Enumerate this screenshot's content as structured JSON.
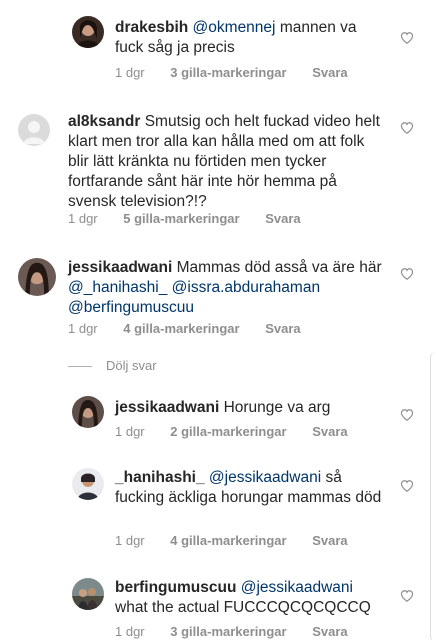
{
  "comments": [
    {
      "username": "drakesbih",
      "mention": "@okmennej",
      "text": "mannen va fuck såg ja precis",
      "time": "1 dgr",
      "likes": "3 gilla-markeringar",
      "reply": "Svara"
    },
    {
      "username": "al8ksandr",
      "text": "Smutsig och helt fuckad video helt klart men tror alla kan hålla med om att folk blir lätt kränkta nu förtiden men tycker fortfarande sånt här inte hör hemma på svensk television?!?",
      "time": "1 dgr",
      "likes": "5 gilla-markeringar",
      "reply": "Svara"
    },
    {
      "username": "jessikaadwani",
      "text": "Mammas död asså va äre här",
      "mention1": "@_hanihashi_",
      "mention2": "@issra.abdurahaman",
      "mention3": "@berfingumuscuu",
      "time": "1 dgr",
      "likes": "4 gilla-markeringar",
      "reply": "Svara"
    }
  ],
  "hide_replies": "Dölj svar",
  "replies": [
    {
      "username": "jessikaadwani",
      "text": "Horunge va arg",
      "time": "1 dgr",
      "likes": "2 gilla-markeringar",
      "reply": "Svara"
    },
    {
      "username": "_hanihashi_",
      "mention": "@jessikaadwani",
      "text": "så fucking äckliga horungar mammas död",
      "time": "1 dgr",
      "likes": "4 gilla-markeringar",
      "reply": "Svara"
    },
    {
      "username": "berfingumuscuu",
      "mention": "@jessikaadwani",
      "text": "what the actual FUCCCQCQCQCCQ",
      "time": "1 dgr",
      "likes": "3 gilla-markeringar",
      "reply": "Svara"
    }
  ],
  "icons": {
    "like": "heart-outline-icon",
    "default_avatar": "default-avatar-icon"
  }
}
